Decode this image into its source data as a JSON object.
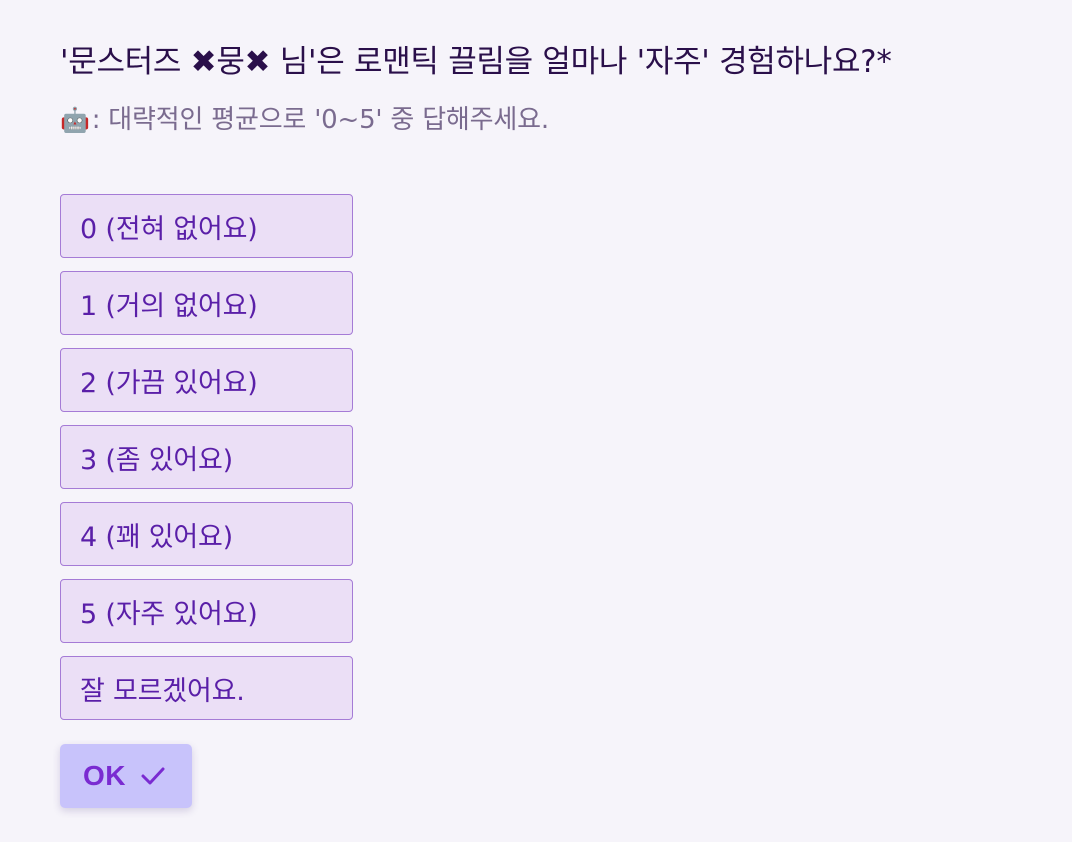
{
  "question": {
    "title": "'문스터즈 ✖뭉✖ 님'은 로맨틱 끌림을 얼마나 '자주' 경험하나요?*",
    "hint_icon": "🤖",
    "hint": ": 대략적인 평균으로 '0~5' 중 답해주세요."
  },
  "options": [
    {
      "label": "0 (전혀 없어요)"
    },
    {
      "label": "1 (거의 없어요)"
    },
    {
      "label": "2 (가끔 있어요)"
    },
    {
      "label": "3 (좀 있어요)"
    },
    {
      "label": "4 (꽤 있어요)"
    },
    {
      "label": "5 (자주 있어요)"
    },
    {
      "label": "잘 모르겠어요."
    }
  ],
  "submit": {
    "label": "OK",
    "icon": "check-icon"
  },
  "colors": {
    "background": "#f6f4fa",
    "option_bg": "#ebdff6",
    "option_border": "#a57bd6",
    "option_text": "#5a1fa8",
    "ok_bg": "#c8c3fb",
    "ok_text": "#7a2bd1"
  }
}
